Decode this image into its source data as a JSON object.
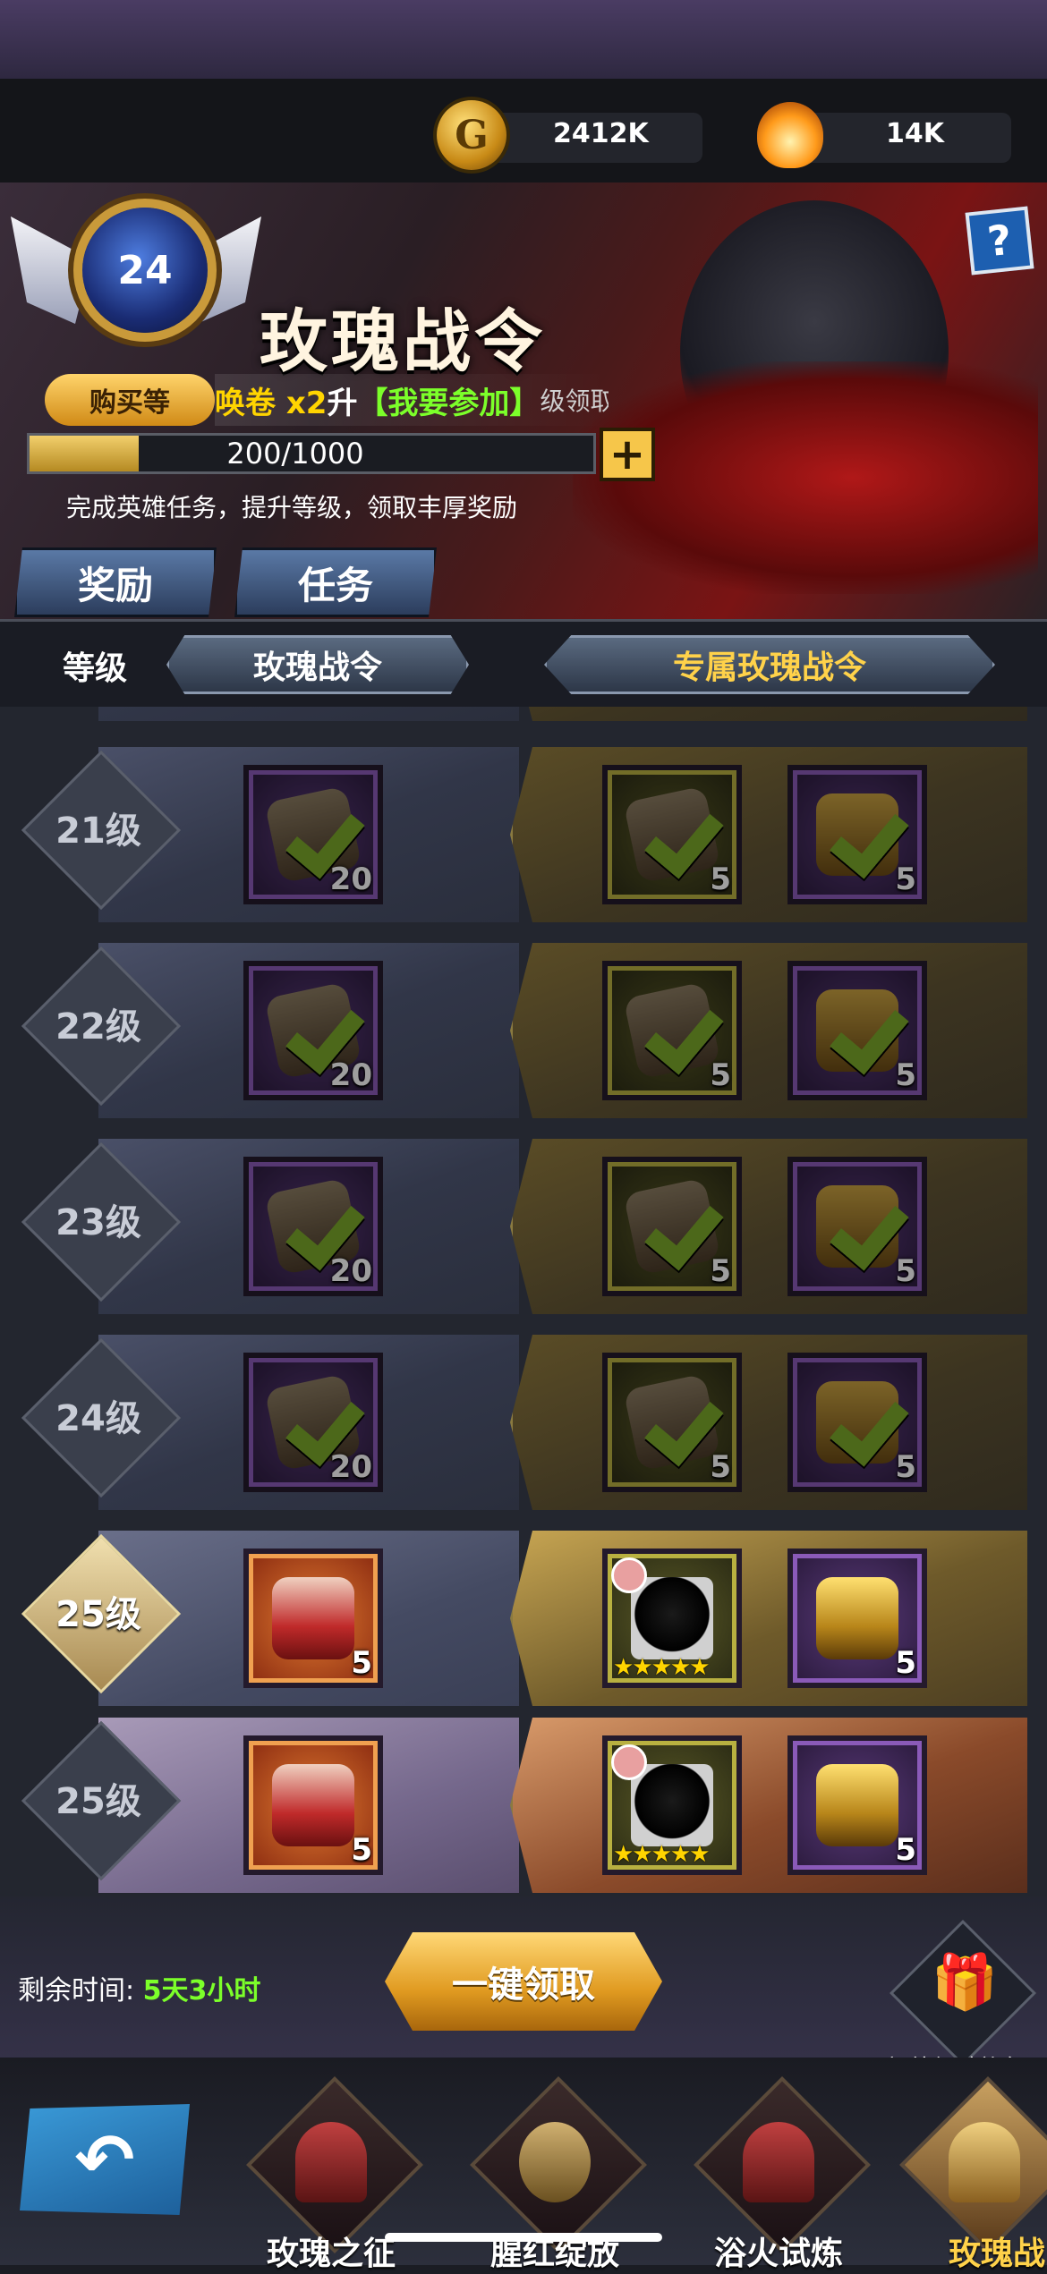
{
  "resources": {
    "gold": "2412K",
    "energy": "14K"
  },
  "banner": {
    "level": "24",
    "title": "玫瑰战令",
    "help": "?",
    "buy_level": "购买等",
    "marquee_prefix": "唤卷 x2",
    "marquee_mid": "升",
    "marquee_join": "【我要参加】",
    "marquee_suffix": "级领取罗丝",
    "exp": "200/1000",
    "plus": "+",
    "description": "完成英雄任务，提升等级，领取丰厚奖励"
  },
  "tabs": [
    {
      "label": "奖励"
    },
    {
      "label": "任务"
    }
  ],
  "header": {
    "level": "等级",
    "free": "玫瑰战令",
    "premium": "专属玫瑰战令"
  },
  "rows": [
    {
      "level": "21级",
      "free_qty": "20",
      "prem1_qty": "5",
      "prem2_qty": "5"
    },
    {
      "level": "22级",
      "free_qty": "20",
      "prem1_qty": "5",
      "prem2_qty": "5"
    },
    {
      "level": "23级",
      "free_qty": "20",
      "prem1_qty": "5",
      "prem2_qty": "5"
    },
    {
      "level": "24级",
      "free_qty": "20",
      "prem1_qty": "5",
      "prem2_qty": "5"
    },
    {
      "level": "25级",
      "free_qty": "5",
      "stars": "★★★★★",
      "prem2_qty": "5"
    },
    {
      "level": "25级",
      "free_qty": "5",
      "stars": "★★★★★",
      "prem2_qty": "5"
    }
  ],
  "bottom": {
    "time_label": "剩余时间: ",
    "time_value": "5天3小时",
    "claim_all": "一键领取",
    "gift_label": "额外经验礼包"
  },
  "nav": [
    {
      "label": "玫瑰之征"
    },
    {
      "label": "腥红绽放"
    },
    {
      "label": "浴火试炼"
    },
    {
      "label": "玫瑰战"
    }
  ],
  "icons": [
    "gold-coin-icon",
    "flame-icon",
    "help-icon",
    "check-icon",
    "gift-icon",
    "back-arrow-icon"
  ],
  "colors": {
    "accent_gold": "#ffd24a",
    "time_green": "#7cff2a",
    "join_green": "#7cff2a",
    "marquee_yellow": "#ffd400"
  }
}
